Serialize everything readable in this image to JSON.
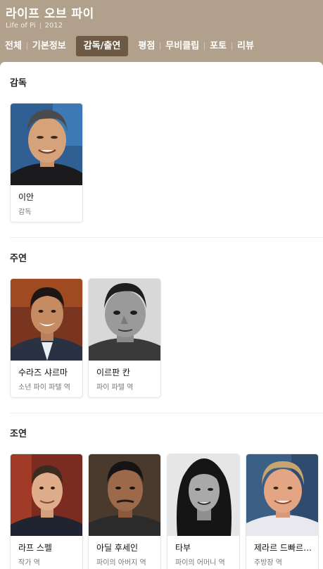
{
  "movie": {
    "title": "라이프 오브 파이",
    "original_title": "Life of Pi",
    "year": "2012"
  },
  "tabs": [
    {
      "label": "전체"
    },
    {
      "label": "기본정보"
    },
    {
      "label": "감독/출연",
      "active": true
    },
    {
      "label": "평점"
    },
    {
      "label": "무비클립"
    },
    {
      "label": "포토"
    },
    {
      "label": "리뷰"
    }
  ],
  "sections": {
    "director": {
      "title": "감독",
      "people": [
        {
          "name": "이안",
          "role": "감독"
        }
      ]
    },
    "lead": {
      "title": "주연",
      "people": [
        {
          "name": "수라즈 샤르마",
          "role": "소년 파이 파텔 역"
        },
        {
          "name": "이르판 칸",
          "role": "파이 파텔 역"
        }
      ]
    },
    "supporting": {
      "title": "조연",
      "people": [
        {
          "name": "라프 스펠",
          "role": "작가 역"
        },
        {
          "name": "아딜 후세인",
          "role": "파이의 아버지 역"
        },
        {
          "name": "타부",
          "role": "파이의 어머니 역"
        },
        {
          "name": "제라르 드빠르디유",
          "role": "주방장 역"
        }
      ]
    }
  },
  "colors": {
    "header_bg": "#b1a08b",
    "active_tab_bg": "#6e5a44"
  }
}
